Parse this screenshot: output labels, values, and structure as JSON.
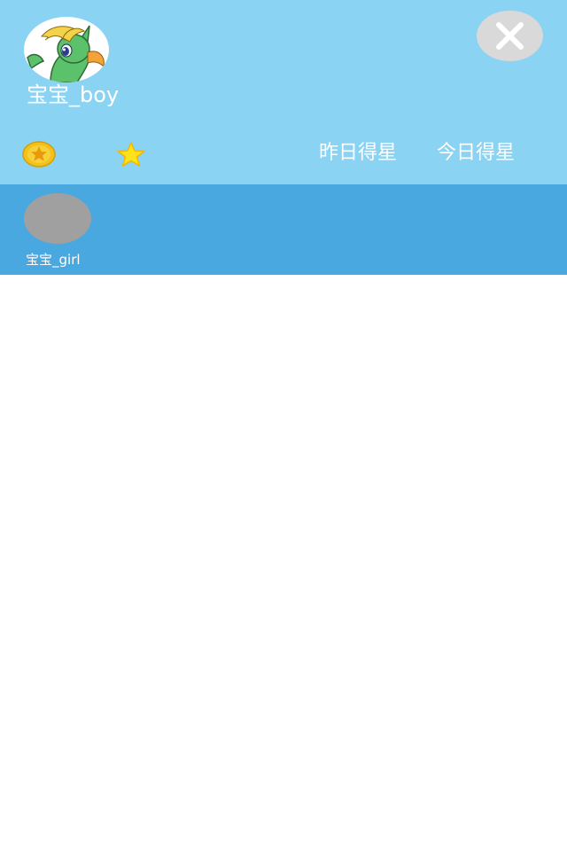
{
  "header": {
    "username": "宝宝_boy",
    "avatar": "pony-avatar",
    "close_icon": "close-icon",
    "coin_icon": "coin-icon",
    "star_icon": "star-icon",
    "tabs": [
      {
        "label": "昨日得星"
      },
      {
        "label": "今日得星"
      }
    ]
  },
  "children": [
    {
      "name": "宝宝_girl",
      "avatar": "placeholder-avatar"
    }
  ],
  "colors": {
    "header_bg": "#8bd3f3",
    "row_bg": "#4aa8e0",
    "close_bg": "#d9d9d9",
    "coin_gold": "#f2c21b",
    "star_yellow": "#ffe21a",
    "text": "#ffffff"
  }
}
